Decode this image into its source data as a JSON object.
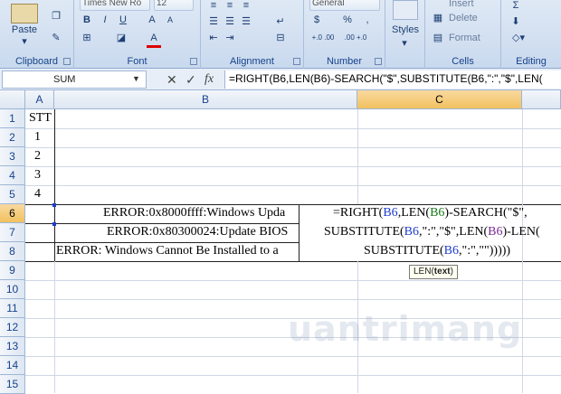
{
  "ribbon": {
    "clipboard": {
      "label": "Clipboard",
      "paste_label": "Paste"
    },
    "font": {
      "label": "Font",
      "font_name": "Times New Ro",
      "font_size": "12"
    },
    "alignment": {
      "label": "Alignment"
    },
    "number": {
      "label": "Number",
      "format": "General",
      "currency": "$",
      "percent": "%",
      "comma": ",",
      "inc_decimal": "+.0 .00",
      "dec_decimal": ".00 +.0"
    },
    "styles": {
      "label": "Styles"
    },
    "cells": {
      "label": "Cells",
      "insert": "Insert",
      "delete": "Delete",
      "format": "Format"
    },
    "editing": {
      "label": "Editing",
      "sum": "Σ"
    }
  },
  "formula_bar": {
    "name_box": "SUM",
    "cancel": "✕",
    "enter": "✓",
    "fx": "fx",
    "formula": "=RIGHT(B6,LEN(B6)-SEARCH(\"$\",SUBSTITUTE(B6,\":\",\"$\",LEN("
  },
  "grid": {
    "columns": [
      "A",
      "B",
      "C"
    ],
    "rows": [
      "1",
      "2",
      "3",
      "4",
      "5",
      "6",
      "7",
      "8",
      "9",
      "10",
      "11",
      "12",
      "13",
      "14",
      "15"
    ],
    "cells": {
      "A1": "STT",
      "A2": "1",
      "A3": "2",
      "A4": "3",
      "A5": "4",
      "B6": "ERROR:0x8000ffff:Windows Upda",
      "B7": "ERROR:0x80300024:Update BIOS",
      "B8": "ERROR: Windows Cannot Be Installed to a"
    },
    "edit_formula": {
      "line1_a": "=RIGHT(",
      "line1_b": "B6",
      "line1_c": ",LEN(",
      "line1_d": "B6",
      "line1_e": ")-SEARCH(\"$\",",
      "line2_a": "SUBSTITUTE(",
      "line2_b": "B6",
      "line2_c": ",\":\",\"$\",LEN(",
      "line2_d": "B6",
      "line2_e": ")-LEN(",
      "line3_a": "SUBSTITUTE(",
      "line3_b": "B6",
      "line3_c": ",\":\",\"\")))))"
    },
    "tooltip": {
      "name": "LEN(",
      "arg": "text",
      "close": ")"
    }
  },
  "watermark": "uantrimang"
}
